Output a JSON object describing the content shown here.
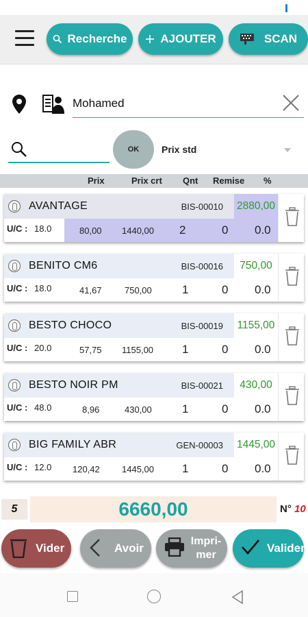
{
  "toolbar": {
    "search_label": "Recherche",
    "add_label": "AJOUTER",
    "scan_label": "SCAN",
    "teal": "#26a9a9"
  },
  "client": {
    "name": "Mohamed"
  },
  "search": {
    "ok_label": "OK",
    "price_type": "Prix std"
  },
  "columns": {
    "prix": "Prix",
    "prix_crt": "Prix crt",
    "qnt": "Qnt",
    "remise": "Remise",
    "percent": "%"
  },
  "products": [
    {
      "name": "AVANTAGE",
      "code": "BIS-00010",
      "total": "2880,00",
      "uc_label": "U/C :",
      "uc": "18.0",
      "prix": "80,00",
      "prix_crt": "1440,00",
      "qnt": "2",
      "remise": "0",
      "pct": "0.0",
      "selected": true
    },
    {
      "name": "BENITO CM6",
      "code": "BIS-00016",
      "total": "750,00",
      "uc_label": "U/C :",
      "uc": "18.0",
      "prix": "41,67",
      "prix_crt": "750,00",
      "qnt": "1",
      "remise": "0",
      "pct": "0.0",
      "selected": false
    },
    {
      "name": "BESTO CHOCO",
      "code": "BIS-00019",
      "total": "1155,00",
      "uc_label": "U/C :",
      "uc": "20.0",
      "prix": "57,75",
      "prix_crt": "1155,00",
      "qnt": "1",
      "remise": "0",
      "pct": "0.0",
      "selected": false
    },
    {
      "name": "BESTO NOIR PM",
      "code": "BIS-00021",
      "total": "430,00",
      "uc_label": "U/C :",
      "uc": "48.0",
      "prix": "8,96",
      "prix_crt": "430,00",
      "qnt": "1",
      "remise": "0",
      "pct": "0.0",
      "selected": false
    },
    {
      "name": "BIG FAMILY ABR",
      "code": "GEN-00003",
      "total": "1445,00",
      "uc_label": "U/C :",
      "uc": "12.0",
      "prix": "120,42",
      "prix_crt": "1445,00",
      "qnt": "1",
      "remise": "0",
      "pct": "0.0",
      "selected": false
    }
  ],
  "footer": {
    "count": "5",
    "total": "6660,00",
    "num_label": "N°",
    "num_value": "10"
  },
  "actions": {
    "vider": "Vider",
    "avoir": "Avoir",
    "imprimer_line1": "Impri-",
    "imprimer_line2": "mer",
    "valider": "Valider"
  },
  "icons": {
    "menu": "hamburger-menu-icon",
    "search": "search-icon",
    "add": "plus-icon",
    "scan": "barcode-icon",
    "location": "location-pin-icon",
    "client": "person-icon",
    "clear": "close-icon",
    "product": "coin-icon",
    "delete": "trash-icon"
  }
}
